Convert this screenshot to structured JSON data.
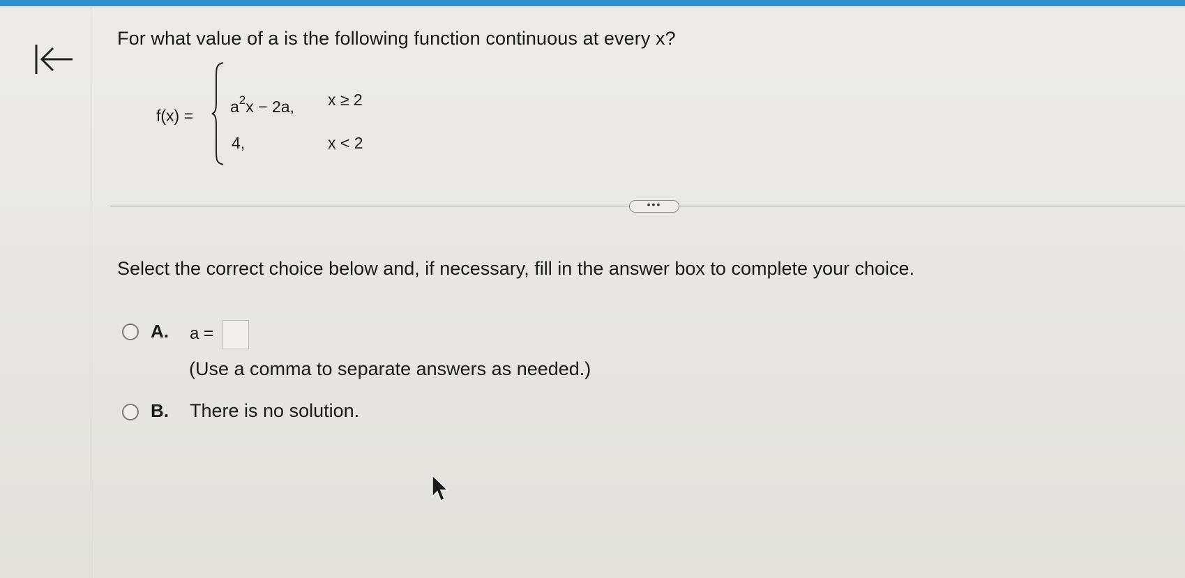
{
  "navigation": {
    "back_icon": "arrow-left-to-bar-icon"
  },
  "question": {
    "text": "For what value of a is the following function continuous at every x?",
    "function_label": "f(x) =",
    "cases": [
      {
        "expr_base": "a",
        "expr_exponent": "2",
        "expr_rest": "x − 2a,",
        "condition": "x ≥ 2"
      },
      {
        "expr": "4,",
        "condition": "x < 2"
      }
    ]
  },
  "divider": {
    "more_label": "•••"
  },
  "instruction": "Select the correct choice below and, if necessary, fill in the answer box to complete your choice.",
  "choices": [
    {
      "letter": "A.",
      "prefix": "a =",
      "answer_value": "",
      "hint": "(Use a comma to separate answers as needed.)"
    },
    {
      "letter": "B.",
      "text": "There is no solution."
    }
  ],
  "colors": {
    "topbar": "#2f8fcf",
    "background": "#e9e8e4"
  }
}
